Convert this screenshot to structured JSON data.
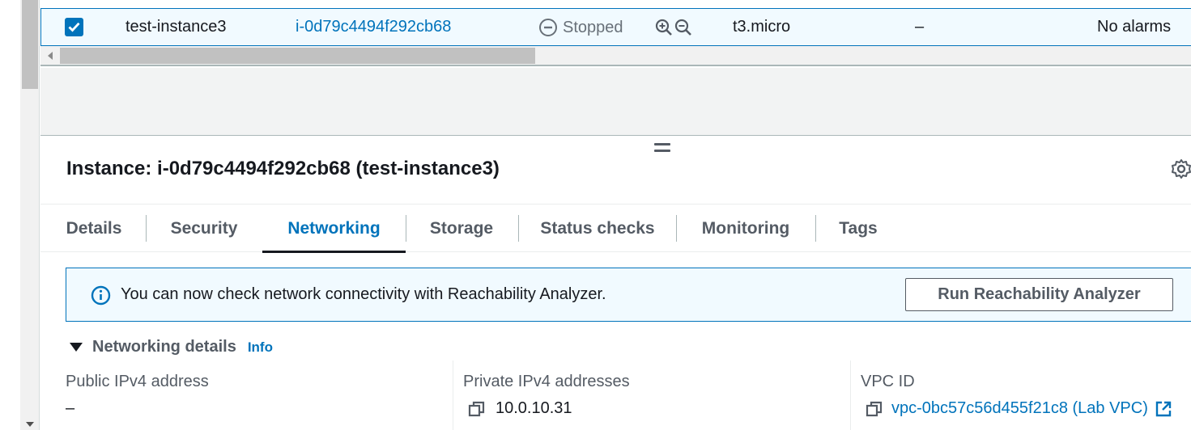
{
  "table_row": {
    "selected": true,
    "name": "test-instance3",
    "instance_id": "i-0d79c4494f292cb68",
    "state": "Stopped",
    "instance_type": "t3.micro",
    "status_check": "–",
    "alarm_status": "No alarms"
  },
  "panel": {
    "title": "Instance: i-0d79c4494f292cb68 (test-instance3)"
  },
  "tabs": [
    {
      "label": "Details"
    },
    {
      "label": "Security"
    },
    {
      "label": "Networking",
      "active": true
    },
    {
      "label": "Storage"
    },
    {
      "label": "Status checks"
    },
    {
      "label": "Monitoring"
    },
    {
      "label": "Tags"
    }
  ],
  "alert": {
    "message": "You can now check network connectivity with Reachability Analyzer.",
    "button_label": "Run Reachability Analyzer"
  },
  "networking": {
    "section_title": "Networking details",
    "info_label": "Info",
    "public_ipv4_label": "Public IPv4 address",
    "public_ipv4_value": "–",
    "private_ipv4_label": "Private IPv4 addresses",
    "private_ipv4_value": "10.0.10.31",
    "vpc_label": "VPC ID",
    "vpc_value": "vpc-0bc57c56d455f21c8 (Lab VPC)"
  },
  "colors": {
    "accent": "#0073bb",
    "text": "#16191f",
    "muted": "#545b64"
  }
}
